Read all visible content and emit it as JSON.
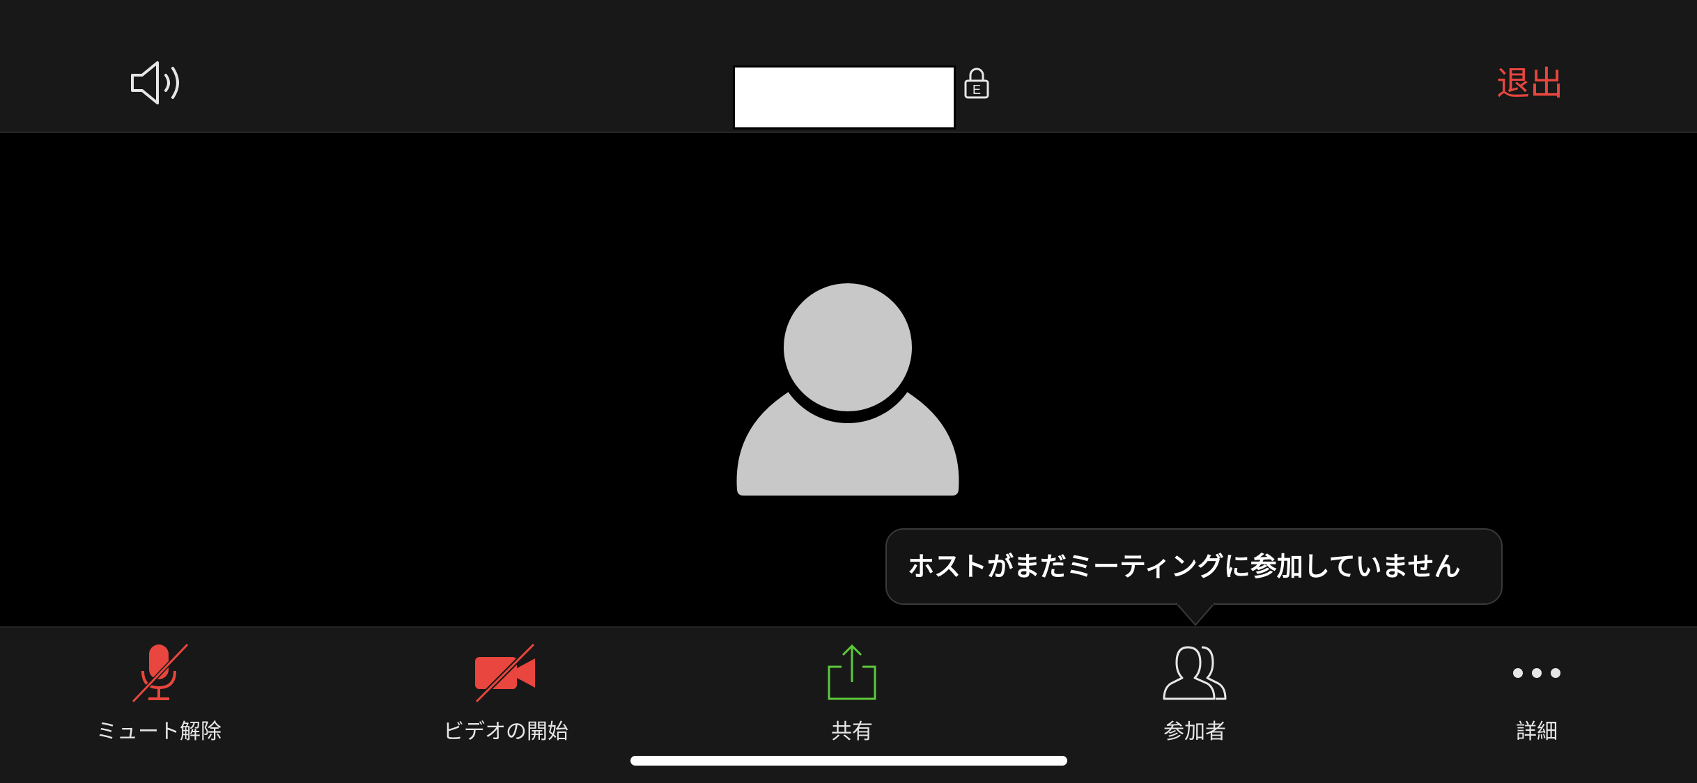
{
  "header": {
    "speaker_icon": "speaker-volume-icon",
    "meeting_id_redacted": true,
    "lock_icon": "encryption-lock-icon",
    "lock_badge": "E",
    "leave_label": "退出",
    "leave_color": "#e8463e"
  },
  "main": {
    "avatar_icon": "person-avatar-icon"
  },
  "tooltip": {
    "text": "ホストがまだミーティングに参加していません"
  },
  "toolbar": {
    "items": [
      {
        "id": "mute",
        "label": "ミュート解除",
        "icon": "muted-microphone-icon",
        "color": "#e8463e"
      },
      {
        "id": "video",
        "label": "ビデオの開始",
        "icon": "video-off-icon",
        "color": "#e8463e"
      },
      {
        "id": "share",
        "label": "共有",
        "icon": "share-upload-icon",
        "color": "#5cc93b"
      },
      {
        "id": "participants",
        "label": "参加者",
        "icon": "participants-icon",
        "color": "#e6e6e6"
      },
      {
        "id": "more",
        "label": "詳細",
        "icon": "more-dots-icon",
        "color": "#e6e6e6"
      }
    ]
  }
}
